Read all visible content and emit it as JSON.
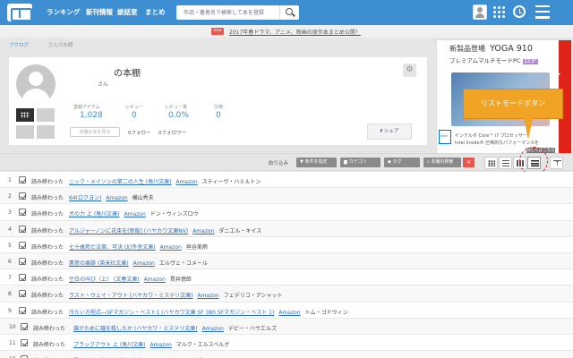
{
  "nav": {
    "links": [
      "ランキング",
      "新刊情報",
      "談話室",
      "まとめ"
    ],
    "search_placeholder": "作品・著者名で検索して本を登録"
  },
  "notice": {
    "badge": "new",
    "text": "2017年春ドラマ、アニメ、映画の原作本まとめ公開！"
  },
  "breadcrumb": [
    "ブクログ",
    "さんの本棚"
  ],
  "profile": {
    "title": "の本棚",
    "san": "さん",
    "stats": [
      {
        "label": "登録アイテム",
        "value": "1,028"
      },
      {
        "label": "レビュー",
        "value": "0"
      },
      {
        "label": "レビュー率",
        "value": "0.0%"
      },
      {
        "label": "引用",
        "value": "0"
      }
    ],
    "shelf_button": "本棚の本を見る",
    "follow": "0フォロー",
    "follower": "0フォロワー",
    "share": "シェア",
    "share_icon_text": "f"
  },
  "ad": {
    "title": "新製品登場",
    "model": "YOGA 910",
    "subtitle": "プレミアムマルチモードPC",
    "size": "13.9\"",
    "brand": "Lenovo",
    "footer1": "インテル® Core™ i7 プロセッサー",
    "footer2": "Intel Inside® 圧倒的なパフォーマンスを",
    "detail": "詳しくはこちら",
    "intel_text": "intel"
  },
  "callout": "リストモードボタン",
  "filter": {
    "label": "絞り込み",
    "buttons": [
      "条件を指定",
      "カテゴリ",
      "タグ",
      "本棚内検索"
    ],
    "close": "×"
  },
  "rows": [
    {
      "num": "1",
      "status": "読み終わった",
      "title": "ニック・メイソンの第二の人生 (角川文庫)",
      "store": "Amazon",
      "author": "スティーヴ・ハミルトン"
    },
    {
      "num": "2",
      "status": "読み終わった",
      "title": "64(ロクヨン)",
      "store": "Amazon",
      "author": "横山秀夫"
    },
    {
      "num": "3",
      "status": "読み終わった",
      "title": "犬の力 上 (角川文庫)",
      "store": "Amazon",
      "author": "ドン・ウィンズロウ"
    },
    {
      "num": "4",
      "status": "読み終わった",
      "title": "アルジャーノンに花束を[新版] (ハヤカワ文庫NV)",
      "store": "Amazon",
      "author": "ダニエル・キイス"
    },
    {
      "num": "5",
      "status": "読み終わった",
      "title": "七十歳死亡法案、可決 (幻冬舎文庫)",
      "store": "Amazon",
      "author": "垣谷美雨"
    },
    {
      "num": "6",
      "status": "読み終わった",
      "title": "悪意の痕跡 (英米社文庫)",
      "store": "Amazon",
      "author": "エルヴェ・コメール"
    },
    {
      "num": "7",
      "status": "読み終わった",
      "title": "空白の叫び（上） (文春文庫)",
      "store": "Amazon",
      "author": "貫井徳郎"
    },
    {
      "num": "8",
      "status": "読み終わった",
      "title": "ラスト・ウェイ・アウト (ハヤカワ・ミステリ文庫)",
      "store": "Amazon",
      "author": "フェデリコ・アシャット"
    },
    {
      "num": "9",
      "status": "読み終わった",
      "title": "冷たい方程式―SFマガジン・ベスト1 (ハヤカワ文庫 SF 380 SFマガジン・ベスト 1)",
      "store": "Amazon",
      "author": "トム・ゴドウィン"
    },
    {
      "num": "10",
      "status": "読み終わった",
      "title": "誰がために鐘を殺したか (ハヤカワ・ミステリ文庫)",
      "store": "Amazon",
      "author": "デビー・ハウエルズ"
    },
    {
      "num": "11",
      "status": "読み終わった",
      "title": "ブラックアウト 上 (角川文庫)",
      "store": "Amazon",
      "author": "マルク・エルスベルグ"
    },
    {
      "num": "12",
      "status": "読み終わった",
      "title": "霧のなかの街 (創元推理文庫)",
      "store": "Amazon",
      "author": "ジェイ・ディ・ル・フィ"
    }
  ]
}
